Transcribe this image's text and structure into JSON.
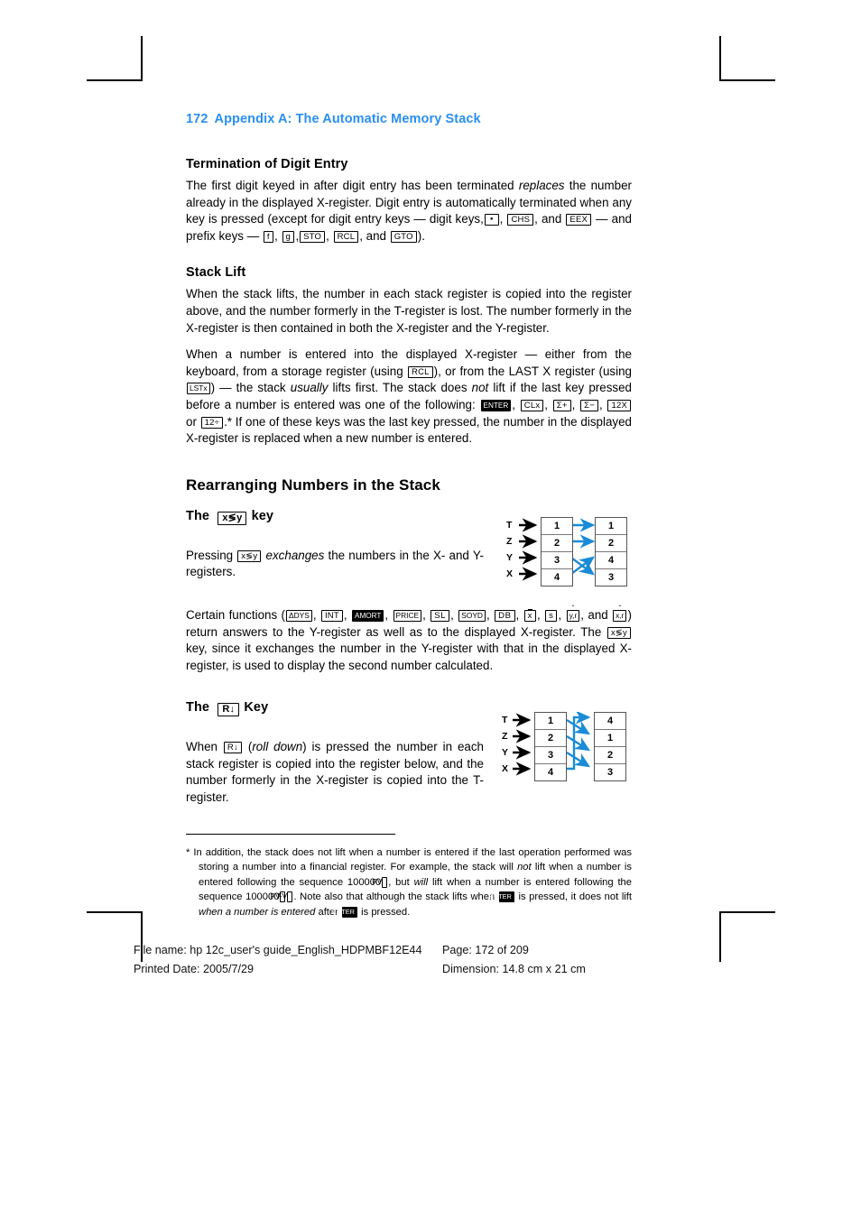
{
  "running_head": {
    "page_number": "172",
    "title": "Appendix A: The Automatic Memory Stack",
    "color": "#2a8ff0"
  },
  "sections": [
    {
      "id": "termination",
      "heading": "Termination of Digit Entry",
      "paragraph_parts": {
        "p1_a": "The first digit keyed in after digit entry has been terminated ",
        "p1_replaces": "replaces",
        "p1_b": " the number already in the displayed X-register. Digit entry is automatically terminated when any key is pressed (except for digit entry keys — digit keys,",
        "p1_c": ", ",
        "p1_d": ", and ",
        "p1_e": " — and prefix keys — ",
        "p1_f": ", ",
        "p1_g": ",",
        "p1_h": ", ",
        "p1_i": ", and ",
        "p1_j": ")."
      },
      "keys": {
        "dot": "",
        "chs": "CHS",
        "eex": "EEX",
        "f": "f",
        "g": "g",
        "sto": "STO",
        "rcl": "RCL",
        "gto": "GTO"
      }
    },
    {
      "id": "stack-lift",
      "heading": "Stack Lift",
      "p1": "When the stack lifts, the number in each stack register is copied into the register above, and the number formerly in the T-register is lost. The number formerly in the X-register is then contained in both the X-register and the Y-register.",
      "p2_parts": {
        "a": "When a number is entered into the displayed X-register — either from the keyboard, from a storage register (using ",
        "b": "), or from the LAST X register (using ",
        "c": ") — the stack ",
        "usually": "usually",
        "d": " lifts first. The stack does ",
        "not": "not",
        "e": " lift if the last key pressed before a number is entered was one of the following: ",
        "f": ", ",
        "g": ", ",
        "h": ", ",
        "i": ", ",
        "j": " or ",
        "k": ".* If one of these keys was the last key pressed, the number in the displayed X-register is replaced when a new number is entered."
      },
      "keys": {
        "rcl": "RCL",
        "lstx": "LSTx",
        "enter": "ENTER",
        "clx": "CLx",
        "sigma_plus": "Σ+",
        "sigma_minus": "Σ−",
        "twelve_x": "12X",
        "twelve_div": "12÷"
      }
    }
  ],
  "major_heading": "Rearranging Numbers in the Stack",
  "xy_section": {
    "heading_pre": "The",
    "heading_key": "x≶y",
    "heading_post": "key",
    "p1_a": "Pressing ",
    "p1_key": "x≶y",
    "p1_b": " ",
    "p1_exchanges": "exchanges",
    "p1_c": " the numbers in the X- and Y-registers.",
    "p2_a": "Certain functions (",
    "p2_b": ", ",
    "p2_c": ", and ",
    "p2_d": ") return answers to the Y-register as well as to the displayed X-register. The ",
    "p2_e": " key, since it exchanges the number in the Y-register with that in the displayed X-register, is used to display the second number calculated.",
    "function_keys": [
      "ΔDYS",
      "INT",
      "AMORT",
      "PRICE",
      "SL",
      "SOYD",
      "DB",
      "x",
      "s",
      "y,r",
      "x,r"
    ],
    "diagram": {
      "row_labels": [
        "T",
        "Z",
        "Y",
        "X"
      ],
      "before": [
        "1",
        "2",
        "3",
        "4"
      ],
      "after": [
        "1",
        "2",
        "4",
        "3"
      ],
      "arrow_color": "#1a8bd6",
      "mapping": "T→T, Z→Z, Y↔X swap"
    }
  },
  "rdown_section": {
    "heading_pre": "The",
    "heading_key": "R↓",
    "heading_post": "Key",
    "p1_a": "When ",
    "p1_key": "R↓",
    "p1_b": " (",
    "p1_rolldown": "roll down",
    "p1_c": ") is pressed the number in each stack register is copied into the register below, and the number formerly in the X-register is copied into the T-register.",
    "diagram": {
      "row_labels": [
        "T",
        "Z",
        "Y",
        "X"
      ],
      "before": [
        "1",
        "2",
        "3",
        "4"
      ],
      "after": [
        "4",
        "1",
        "2",
        "3"
      ],
      "arrow_color": "#1a8bd6",
      "mapping": "T→Z, Z→Y, Y→X, X→T (wrap)"
    }
  },
  "footnote": {
    "marker": "*",
    "a": " In addition, the stack does not lift when a number is entered if the last operation performed was storing a number into a financial register. For example, the stack will ",
    "not": "not",
    "b": " lift when a number is entered following the sequence 100000",
    "c": ", but ",
    "will": "will",
    "d": " lift when a number is entered following the sequence 100000",
    "e": ". Note also that although the stack lifts when ",
    "f": " is pressed, it does not lift ",
    "g": "when a number is entered",
    "h": " after ",
    "i": " is pressed.",
    "keys": {
      "pv": "PV",
      "fv": "FV",
      "enter": "ENTER"
    }
  },
  "page_footer": {
    "file_name_label": "File name: hp 12c_user's guide_English_HDPMBF12E44",
    "page_label": "Page: 172 of 209",
    "printed_date_label": "Printed Date: 2005/7/29",
    "dimension_label": "Dimension: 14.8 cm x 21 cm"
  }
}
